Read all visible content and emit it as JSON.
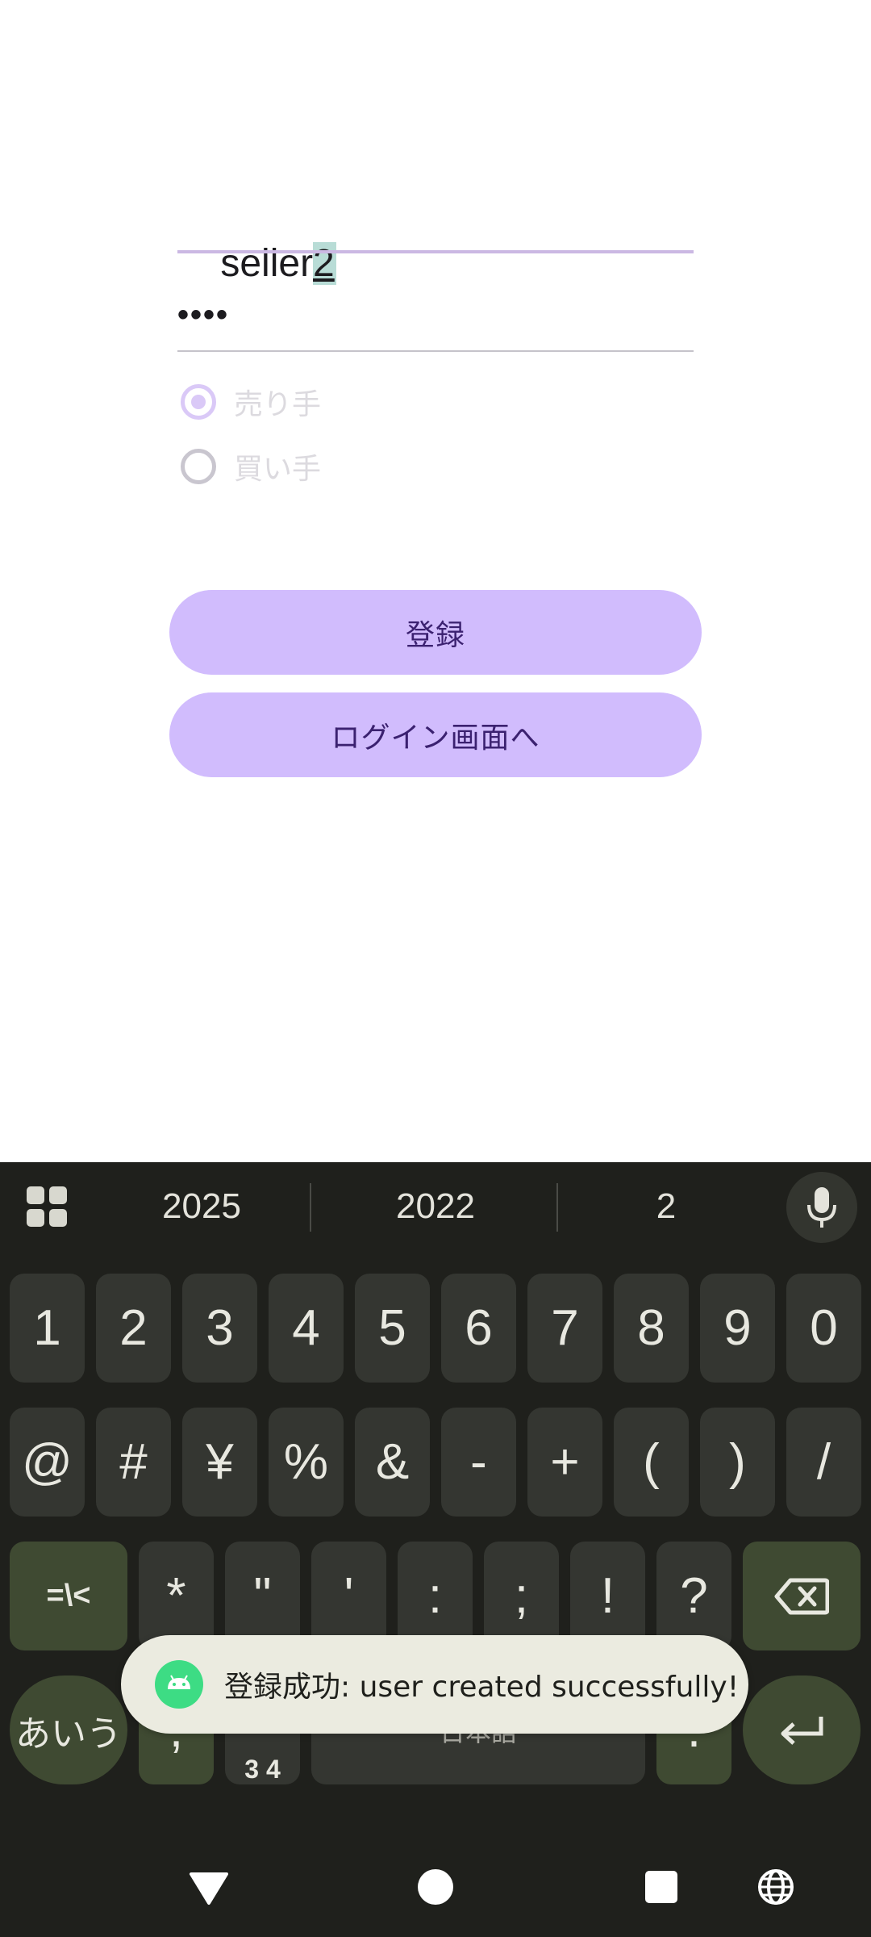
{
  "form": {
    "username_prefix": "seller",
    "username_selected": "2",
    "password_mask": "••••",
    "role_options": [
      {
        "label": "売り手",
        "checked": true
      },
      {
        "label": "買い手",
        "checked": false
      }
    ],
    "register_label": "登録",
    "to_login_label": "ログイン画面へ"
  },
  "keyboard": {
    "suggestions": [
      "2025",
      "2022",
      "2"
    ],
    "row1": [
      "1",
      "2",
      "3",
      "4",
      "5",
      "6",
      "7",
      "8",
      "9",
      "0"
    ],
    "row2": [
      "@",
      "#",
      "¥",
      "%",
      "&",
      "-",
      "+",
      "(",
      ")",
      "/"
    ],
    "row3_mod": "=\\<",
    "row3": [
      "*",
      "\"",
      "'",
      ":",
      ";",
      "!",
      "?"
    ],
    "row4_lang": "あいう",
    "row4_comma": ",",
    "row4_numbers": "3 4",
    "row4_space": "日本語",
    "row4_period": ".",
    "icons": [
      "apps-grid-icon",
      "microphone-icon",
      "backspace-icon",
      "enter-icon"
    ]
  },
  "toast": {
    "message": "登録成功: user created successfully!",
    "icon": "android-icon",
    "icon_color": "#3ddc84"
  },
  "navbar": {
    "icons": [
      "back-icon",
      "home-icon",
      "recents-icon",
      "language-icon"
    ]
  },
  "colors": {
    "accent": "#d1bcfd",
    "accent_text": "#3b2170",
    "keyboard_bg": "#1f201c",
    "key_bg": "#343631",
    "mod_key_bg": "#3f4a32"
  }
}
